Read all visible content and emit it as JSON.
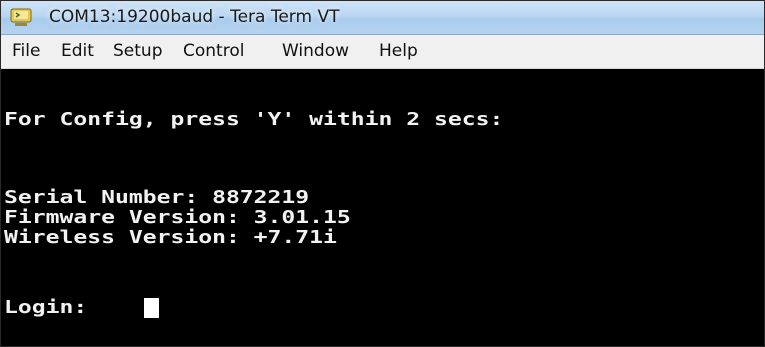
{
  "window": {
    "title": "COM13:19200baud - Tera Term VT",
    "icon": "tera-term-app-icon"
  },
  "menu": {
    "items": [
      "File",
      "Edit",
      "Setup",
      "Control",
      "Window",
      "Help"
    ]
  },
  "terminal": {
    "lines": [
      "For Config, press 'Y' within 2 secs:",
      "Serial Number: 8872219",
      "Firmware Version: 3.01.15",
      "Wireless Version: +7.71i",
      "Login: "
    ],
    "cursor": "block-cursor",
    "colors": {
      "background": "#000000",
      "foreground": "#f2f2f2"
    }
  }
}
